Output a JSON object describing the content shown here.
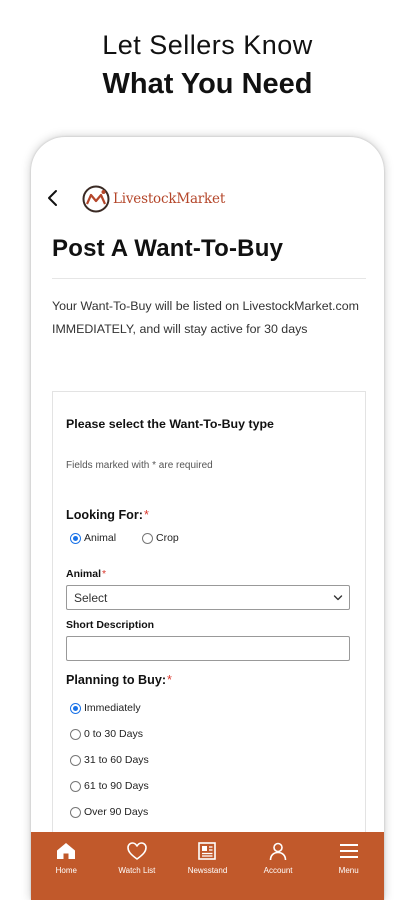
{
  "promo": {
    "line1": "Let Sellers Know",
    "line2": "What You Need"
  },
  "header": {
    "brand": "LivestockMarket"
  },
  "page": {
    "title": "Post A Want-To-Buy",
    "intro": "Your Want-To-Buy will be listed on LivestockMarket.com IMMEDIATELY, and will stay active for 30 days"
  },
  "form": {
    "heading": "Please select the Want-To-Buy type",
    "required_note": "Fields marked with * are required",
    "looking_for": {
      "label": "Looking For:",
      "star": "*",
      "options": [
        "Animal",
        "Crop"
      ],
      "selected": "Animal"
    },
    "animal": {
      "label": "Animal",
      "star": "*",
      "value": "Select"
    },
    "short_description": {
      "label": "Short Description",
      "value": ""
    },
    "planning": {
      "label": "Planning to Buy:",
      "star": "*",
      "options": [
        "Immediately",
        "0 to 30 Days",
        "31 to 60 Days",
        "61 to 90 Days",
        "Over 90 Days"
      ],
      "selected": "Immediately"
    }
  },
  "nav": {
    "items": [
      {
        "label": "Home",
        "icon": "home-icon"
      },
      {
        "label": "Watch List",
        "icon": "heart-icon"
      },
      {
        "label": "Newsstand",
        "icon": "newspaper-icon"
      },
      {
        "label": "Account",
        "icon": "user-icon"
      },
      {
        "label": "Menu",
        "icon": "menu-icon"
      }
    ],
    "active": "Home"
  },
  "colors": {
    "accent": "#c1592b",
    "brand_text": "#b4462a",
    "radio_selected": "#1a73e8",
    "required_star": "#d9362b"
  }
}
